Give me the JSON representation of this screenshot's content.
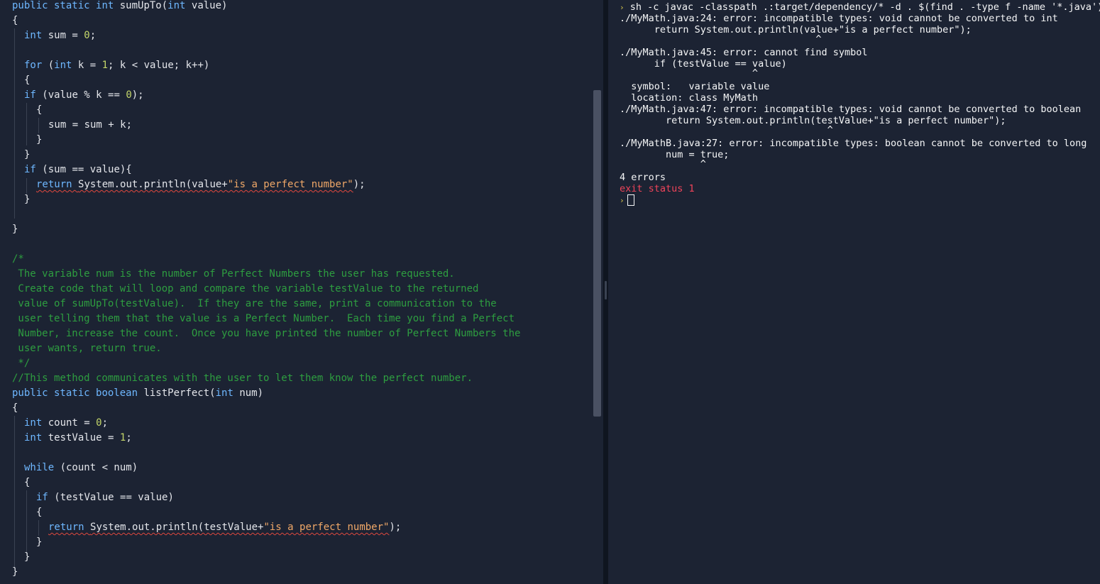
{
  "editor": {
    "lines": {
      "l1": {
        "kw1": "public static ",
        "kw2": "int ",
        "name": "sumUpTo(",
        "kw3": "int ",
        "rest": "value)"
      },
      "l2": "{",
      "l3": {
        "kw": "int ",
        "a": "sum = ",
        "n": "0",
        "b": ";"
      },
      "l4": {
        "kw1": "for ",
        "a": "(",
        "kw2": "int ",
        "b": "k = ",
        "n": "1",
        "c": "; k < value; k++)"
      },
      "l5": "{",
      "l6": {
        "kw": "if ",
        "a": "(value % k == ",
        "n": "0",
        "b": ");"
      },
      "l7": "{",
      "l8": "sum = sum + k;",
      "l9": "}",
      "l10": "}",
      "l11": {
        "kw": "if ",
        "a": "(sum == value){"
      },
      "l12": {
        "kw": "return ",
        "a": "System.out.println(value+",
        "s": "\"is a perfect number\"",
        "b": ");"
      },
      "l13": "}",
      "l14": "}",
      "c1": "/*",
      "c2": " The variable num is the number of Perfect Numbers the user has requested.",
      "c3": " Create code that will loop and compare the variable testValue to the returned",
      "c4": " value of sumUpTo(testValue).  If they are the same, print a communication to the",
      "c5": " user telling them that the value is a Perfect Number.  Each time you find a Perfect",
      "c6": " Number, increase the count.  Once you have printed the number of Perfect Numbers the",
      "c7": " user wants, return true.",
      "c8": " */",
      "c9": "//This method communicates with the user to let them know the perfect number.",
      "m1": {
        "kw1": "public static ",
        "kw2": "boolean ",
        "name": "listPerfect(",
        "kw3": "int ",
        "rest": "num)"
      },
      "m2": "{",
      "m3": {
        "kw": "int ",
        "a": "count = ",
        "n": "0",
        "b": ";"
      },
      "m4": {
        "kw": "int ",
        "a": "testValue = ",
        "n": "1",
        "b": ";"
      },
      "m5": {
        "kw": "while ",
        "a": "(count < num)"
      },
      "m6": "{",
      "m7": {
        "kw": "if ",
        "a": "(testValue == value)"
      },
      "m8": "{",
      "m9": {
        "kw": "return ",
        "a": "System.out.println(testValue+",
        "s": "\"is a perfect number\"",
        "b": ");"
      },
      "m10": "}",
      "m11": "}",
      "m12": "}"
    }
  },
  "console": {
    "prompt_symbol": "›",
    "command": "sh -c javac -classpath .:target/dependency/* -d . $(find . -type f -name '*.java')",
    "errors": [
      {
        "header": "./MyMath.java:24: error: incompatible types: void cannot be converted to int",
        "source": "      return System.out.println(value+\"is a perfect number\");",
        "caret": "                                  ^"
      },
      {
        "header": "./MyMath.java:45: error: cannot find symbol",
        "source": "      if (testValue == value)",
        "caret": "                       ^",
        "symbol": "  symbol:   variable value",
        "location": "  location: class MyMath"
      },
      {
        "header": "./MyMath.java:47: error: incompatible types: void cannot be converted to boolean",
        "source": "        return System.out.println(testValue+\"is a perfect number\");",
        "caret": "                                    ^"
      },
      {
        "header": "./MyMathB.java:27: error: incompatible types: boolean cannot be converted to long",
        "source": "        num = true;",
        "caret": "              ^"
      }
    ],
    "summary": "4 errors",
    "exit_status": "exit status 1"
  }
}
